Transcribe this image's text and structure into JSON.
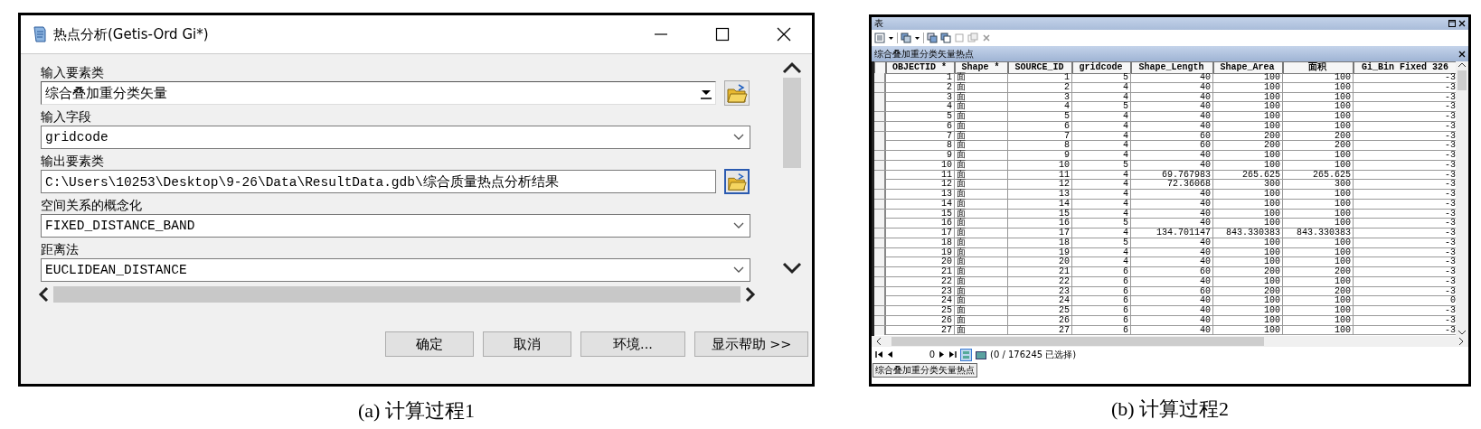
{
  "dialog": {
    "title": "热点分析(Getis-Ord Gi*)",
    "fields": [
      {
        "label": "输入要素类",
        "value": "综合叠加重分类矢量",
        "kind": "combo",
        "browse": {
          "focused": false
        }
      },
      {
        "label": "输入字段",
        "value": "gridcode",
        "kind": "select"
      },
      {
        "label": "输出要素类",
        "value": "C:\\Users\\10253\\Desktop\\9-26\\Data\\ResultData.gdb\\综合质量热点分析结果",
        "kind": "text",
        "browse": {
          "focused": true
        }
      },
      {
        "label": "空间关系的概念化",
        "value": "FIXED_DISTANCE_BAND",
        "kind": "select"
      },
      {
        "label": "距离法",
        "value": "EUCLIDEAN_DISTANCE",
        "kind": "select"
      }
    ],
    "buttons": [
      "确定",
      "取消",
      "环境...",
      "显示帮助 >>"
    ]
  },
  "table_window": {
    "title": "表",
    "layer_title": "综合叠加重分类矢量热点",
    "columns": [
      "OBJECTID *",
      "Shape *",
      "SOURCE_ID",
      "gridcode",
      "Shape_Length",
      "Shape_Area",
      "面积",
      "Gi_Bin Fixed 326"
    ],
    "rows": [
      [
        "1",
        "面",
        "1",
        "5",
        "40",
        "100",
        "100",
        "-3"
      ],
      [
        "2",
        "面",
        "2",
        "4",
        "40",
        "100",
        "100",
        "-3"
      ],
      [
        "3",
        "面",
        "3",
        "4",
        "40",
        "100",
        "100",
        "-3"
      ],
      [
        "4",
        "面",
        "4",
        "5",
        "40",
        "100",
        "100",
        "-3"
      ],
      [
        "5",
        "面",
        "5",
        "4",
        "40",
        "100",
        "100",
        "-3"
      ],
      [
        "6",
        "面",
        "6",
        "4",
        "40",
        "100",
        "100",
        "-3"
      ],
      [
        "7",
        "面",
        "7",
        "4",
        "60",
        "200",
        "200",
        "-3"
      ],
      [
        "8",
        "面",
        "8",
        "4",
        "60",
        "200",
        "200",
        "-3"
      ],
      [
        "9",
        "面",
        "9",
        "4",
        "40",
        "100",
        "100",
        "-3"
      ],
      [
        "10",
        "面",
        "10",
        "5",
        "40",
        "100",
        "100",
        "-3"
      ],
      [
        "11",
        "面",
        "11",
        "4",
        "69.767983",
        "265.625",
        "265.625",
        "-3"
      ],
      [
        "12",
        "面",
        "12",
        "4",
        "72.36068",
        "300",
        "300",
        "-3"
      ],
      [
        "13",
        "面",
        "13",
        "4",
        "40",
        "100",
        "100",
        "-3"
      ],
      [
        "14",
        "面",
        "14",
        "4",
        "40",
        "100",
        "100",
        "-3"
      ],
      [
        "15",
        "面",
        "15",
        "4",
        "40",
        "100",
        "100",
        "-3"
      ],
      [
        "16",
        "面",
        "16",
        "5",
        "40",
        "100",
        "100",
        "-3"
      ],
      [
        "17",
        "面",
        "17",
        "4",
        "134.701147",
        "843.330383",
        "843.330383",
        "-3"
      ],
      [
        "18",
        "面",
        "18",
        "5",
        "40",
        "100",
        "100",
        "-3"
      ],
      [
        "19",
        "面",
        "19",
        "4",
        "40",
        "100",
        "100",
        "-3"
      ],
      [
        "20",
        "面",
        "20",
        "4",
        "40",
        "100",
        "100",
        "-3"
      ],
      [
        "21",
        "面",
        "21",
        "6",
        "60",
        "200",
        "200",
        "-3"
      ],
      [
        "22",
        "面",
        "22",
        "6",
        "40",
        "100",
        "100",
        "-3"
      ],
      [
        "23",
        "面",
        "23",
        "6",
        "60",
        "200",
        "200",
        "-3"
      ],
      [
        "24",
        "面",
        "24",
        "6",
        "40",
        "100",
        "100",
        "0"
      ],
      [
        "25",
        "面",
        "25",
        "6",
        "40",
        "100",
        "100",
        "-3"
      ],
      [
        "26",
        "面",
        "26",
        "6",
        "40",
        "100",
        "100",
        "-3"
      ],
      [
        "27",
        "面",
        "27",
        "6",
        "40",
        "100",
        "100",
        "-3"
      ]
    ],
    "record": "0",
    "status": "(0 / 176245 已选择)",
    "tab": "综合叠加重分类矢量热点"
  },
  "captions": [
    "(a) 计算过程1",
    "(b) 计算过程2"
  ]
}
